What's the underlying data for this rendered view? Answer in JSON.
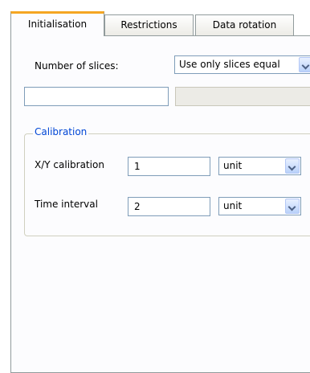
{
  "tabs": [
    {
      "label": "Initialisation",
      "active": true
    },
    {
      "label": "Restrictions",
      "active": false
    },
    {
      "label": "Data rotation",
      "active": false
    }
  ],
  "slices": {
    "label": "Number of slices:",
    "mode_selected": "Use only slices equal",
    "value_field": "",
    "secondary_field": ""
  },
  "calibration": {
    "legend": "Calibration",
    "xy": {
      "label": "X/Y calibration",
      "value": "1",
      "unit": "unit"
    },
    "time": {
      "label": "Time interval",
      "value": "2",
      "unit": "unit"
    }
  },
  "colors": {
    "accent": "#f5a623",
    "legend": "#0046d5",
    "border": "#919b9c"
  }
}
